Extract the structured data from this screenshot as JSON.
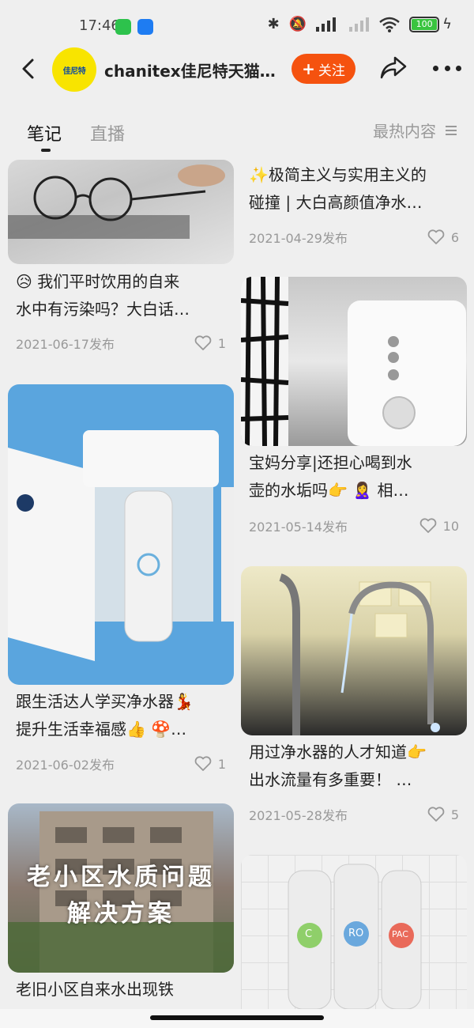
{
  "status_bar": {
    "time": "17:46",
    "battery": "100",
    "icons": [
      "wechat-icon",
      "app-icon",
      "bluetooth-icon",
      "mute-icon",
      "signal-icon",
      "wifi-icon",
      "battery-icon",
      "charging-icon"
    ]
  },
  "header": {
    "shop_name": "chanitex佳尼特天猫…",
    "avatar_text": "佳尼特",
    "follow_label": "关注",
    "icons": [
      "back-icon",
      "share-icon",
      "more-icon"
    ]
  },
  "tabs": {
    "items": [
      {
        "label": "笔记",
        "active": true
      },
      {
        "label": "直播",
        "active": false
      }
    ],
    "sort_label": "最热内容"
  },
  "posts": [
    {
      "column": "left",
      "title_lines": [
        "😥 我们平时饮用的自来",
        "水中有污染吗？大白话…"
      ],
      "date": "2021-06-17发布",
      "likes": "1"
    },
    {
      "column": "right",
      "title_lines": [
        "✨极简主义与实用主义的",
        "碰撞 | 大白高颜值净水…"
      ],
      "date": "2021-04-29发布",
      "likes": "6"
    },
    {
      "column": "right",
      "title_lines": [
        "宝妈分享|还担心喝到水",
        "壶的水垢吗👉 🙎‍♀️ 相…"
      ],
      "date": "2021-05-14发布",
      "likes": "10"
    },
    {
      "column": "left",
      "title_lines": [
        "跟生活达人学买净水器💃",
        "提升生活幸福感👍 🍄…"
      ],
      "date": "2021-06-02发布",
      "likes": "1"
    },
    {
      "column": "right",
      "title_lines": [
        "用过净水器的人才知道👉",
        "出水流量有多重要！ …"
      ],
      "date": "2021-05-28发布",
      "likes": "5"
    },
    {
      "column": "left",
      "title_lines": [
        "老旧小区自来水出现铁"
      ],
      "overlay_lines": [
        "老小区水质问题",
        "解决方案"
      ]
    },
    {
      "column": "right",
      "filter_labels": [
        "C",
        "RO",
        "PAC"
      ]
    }
  ]
}
